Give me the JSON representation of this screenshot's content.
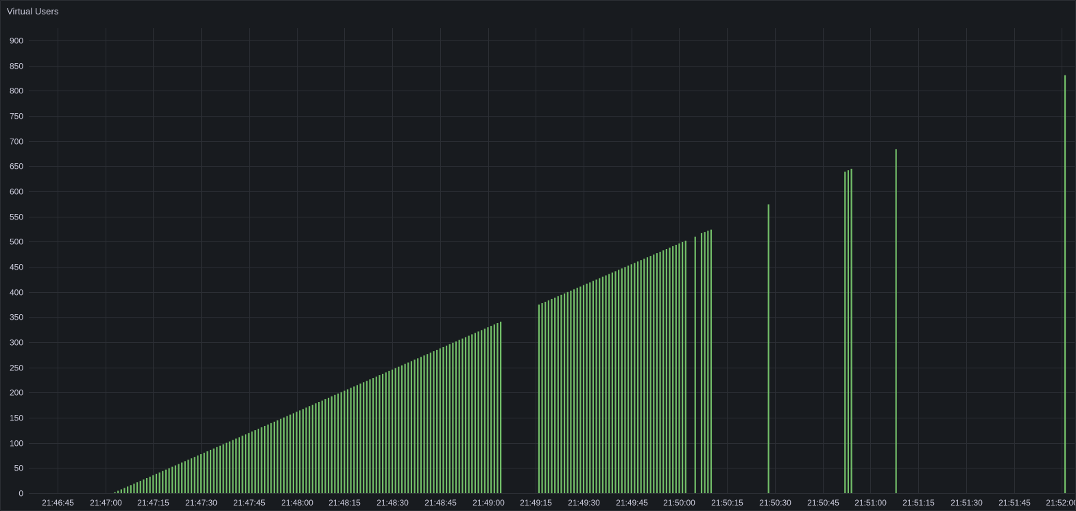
{
  "panel": {
    "title": "Virtual Users"
  },
  "colors": {
    "background": "#181b1f",
    "grid": "#2c2f35",
    "bar": "#73bf69",
    "text": "#ccccdc"
  },
  "chart_data": {
    "type": "bar",
    "title": "Virtual Users",
    "xlabel": "",
    "ylabel": "",
    "ylim": [
      0,
      900
    ],
    "xlim": [
      "21:46:36",
      "21:52:04"
    ],
    "y_ticks": [
      "0",
      "50",
      "100",
      "150",
      "200",
      "250",
      "300",
      "350",
      "400",
      "450",
      "500",
      "550",
      "600",
      "650",
      "700",
      "750",
      "800",
      "850",
      "900"
    ],
    "x_ticks": [
      "21:46:45",
      "21:47:00",
      "21:47:15",
      "21:47:30",
      "21:47:45",
      "21:48:00",
      "21:48:15",
      "21:48:30",
      "21:48:45",
      "21:49:00",
      "21:49:15",
      "21:49:30",
      "21:49:45",
      "21:50:00",
      "21:50:15",
      "21:50:30",
      "21:50:45",
      "21:51:00",
      "21:51:15",
      "21:51:30",
      "21:51:45",
      "21:52:00"
    ],
    "grid": true,
    "legend": "none",
    "series": [
      {
        "segments": [
          {
            "start": "21:47:03",
            "end": "21:49:04",
            "from": 2,
            "to": 341
          },
          {
            "start": "21:49:16",
            "end": "21:50:02",
            "from": 375,
            "to": 502
          },
          {
            "start": "21:50:05",
            "end": "21:50:05",
            "from": 510,
            "to": 510
          },
          {
            "start": "21:50:07",
            "end": "21:50:10",
            "from": 517,
            "to": 524
          },
          {
            "start": "21:50:28",
            "end": "21:50:28",
            "from": 574,
            "to": 574
          },
          {
            "start": "21:50:52",
            "end": "21:50:54",
            "from": 639,
            "to": 645
          },
          {
            "start": "21:51:08",
            "end": "21:51:08",
            "from": 684,
            "to": 684
          },
          {
            "start": "21:52:01",
            "end": "21:52:01",
            "from": 831,
            "to": 831
          }
        ]
      }
    ]
  }
}
